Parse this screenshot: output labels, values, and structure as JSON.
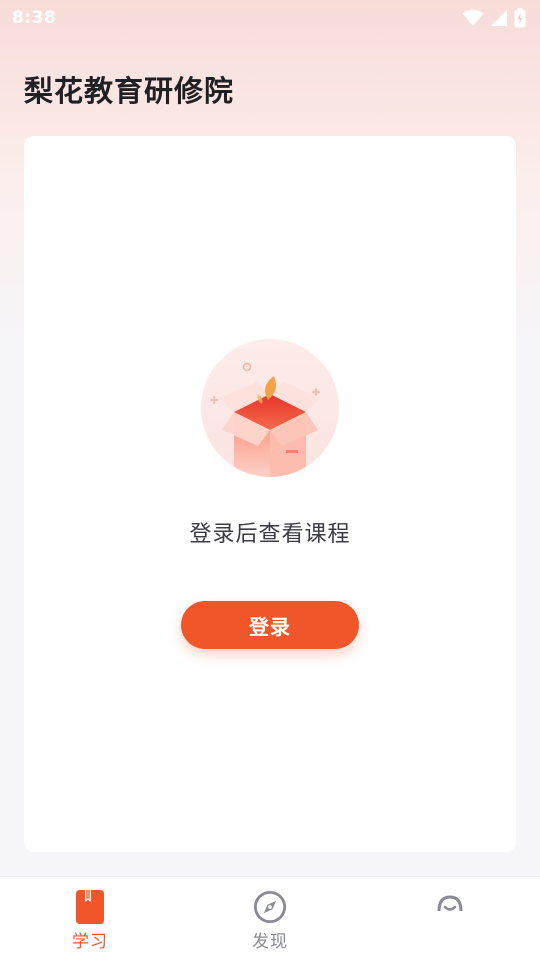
{
  "status_bar": {
    "time": "8:38",
    "icons": [
      "wifi-icon",
      "cellular-signal-icon",
      "battery-charging-icon"
    ]
  },
  "header": {
    "title": "梨花教育研修院"
  },
  "main": {
    "empty_state": {
      "illustration": "empty-box-icon",
      "message": "登录后查看课程"
    },
    "login_button_label": "登录"
  },
  "bottom_nav": {
    "items": [
      {
        "label": "学习",
        "icon": "book-icon",
        "active": true
      },
      {
        "label": "发现",
        "icon": "compass-icon",
        "active": false
      },
      {
        "label": "",
        "icon": "profile-icon",
        "active": false
      }
    ]
  },
  "colors": {
    "accent": "#f0562a",
    "nav_inactive": "#8a8a94",
    "title": "#1f1f24",
    "card_bg": "#ffffff"
  }
}
